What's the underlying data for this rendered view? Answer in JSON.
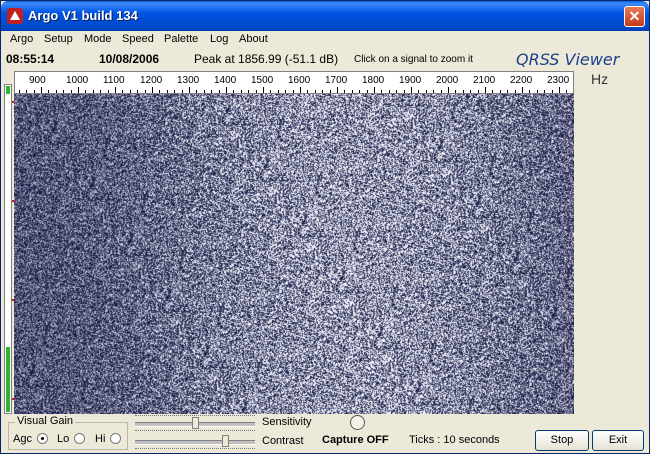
{
  "window": {
    "title": "Argo V1 build 134",
    "close_label": "✕"
  },
  "menu": [
    "Argo",
    "Setup",
    "Mode",
    "Speed",
    "Palette",
    "Log",
    "About"
  ],
  "info": {
    "time": "08:55:14",
    "date": "10/08/2006",
    "peak": "Peak at 1856.99 (-51.1 dB)",
    "hint": "Click on a signal to zoom it",
    "brand": "QRSS Viewer",
    "unit": "Hz"
  },
  "ruler": {
    "labels": [
      "900",
      "1000",
      "1100",
      "1200",
      "1300",
      "1400",
      "1500",
      "1600",
      "1700",
      "1800",
      "1900",
      "2000",
      "2100",
      "2200",
      "2300"
    ]
  },
  "level_meter": {
    "level": 0.2
  },
  "visual_gain": {
    "title": "Visual Gain",
    "options": [
      {
        "label": "Agc",
        "selected": true
      },
      {
        "label": "Lo",
        "selected": false
      },
      {
        "label": "Hi",
        "selected": false
      }
    ]
  },
  "sliders": {
    "sensitivity": {
      "label": "Sensitivity",
      "value": 0.5
    },
    "contrast": {
      "label": "Contrast",
      "value": 0.75
    }
  },
  "capture": {
    "label": "Capture OFF"
  },
  "ticks": {
    "text": "Ticks  : 10 seconds"
  },
  "buttons": {
    "stop": "Stop",
    "exit": "Exit"
  },
  "colors": {
    "title_bar": "#0054e3",
    "spectrogram_bg": "#0a0c2a",
    "level_green": "#2fb52f",
    "marker_red": "#e01010"
  }
}
